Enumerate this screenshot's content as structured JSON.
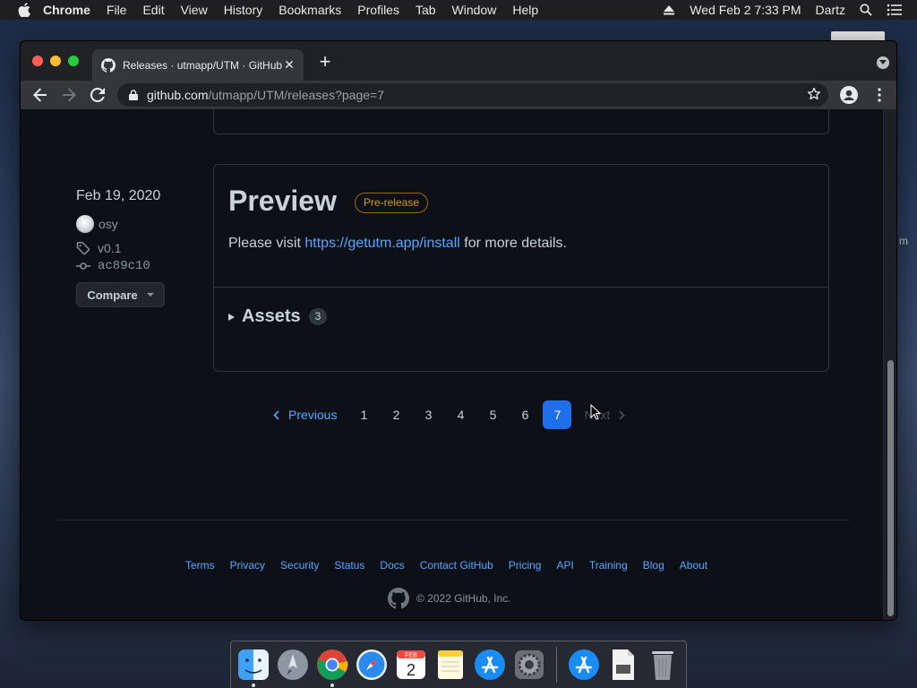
{
  "menubar": {
    "app_name": "Chrome",
    "items": [
      "File",
      "Edit",
      "View",
      "History",
      "Bookmarks",
      "Profiles",
      "Tab",
      "Window",
      "Help"
    ],
    "datetime": "Wed Feb 2  7:33 PM",
    "user": "Dartz"
  },
  "browser": {
    "tab_title": "Releases · utmapp/UTM · GitHub",
    "url_host": "github.com",
    "url_path": "/utmapp/UTM/releases?page=7"
  },
  "release": {
    "date": "Feb 19, 2020",
    "author": "osy",
    "tag": "v0.1",
    "commit": "ac89c10",
    "compare_label": "Compare",
    "title": "Preview",
    "badge": "Pre-release",
    "body_prefix": "Please visit ",
    "body_link": "https://getutm.app/install",
    "body_suffix": " for more details.",
    "assets_label": "Assets",
    "assets_count": "3"
  },
  "pagination": {
    "previous": "Previous",
    "pages": [
      "1",
      "2",
      "3",
      "4",
      "5",
      "6",
      "7"
    ],
    "current": "7",
    "next": "Next"
  },
  "footer": {
    "links": [
      "Terms",
      "Privacy",
      "Security",
      "Status",
      "Docs",
      "Contact GitHub",
      "Pricing",
      "API",
      "Training",
      "Blog",
      "About"
    ],
    "copyright": "© 2022 GitHub, Inc."
  },
  "desktop": {
    "side_label": "m"
  },
  "dock": {
    "apps": [
      "finder-icon",
      "launchpad-icon",
      "chrome-icon",
      "safari-icon",
      "calendar-icon",
      "notes-icon",
      "app-store-icon",
      "system-preferences-icon",
      "utm-icon",
      "file-icon",
      "trash-icon"
    ],
    "calendar_day": "2",
    "calendar_month": "FEB"
  },
  "colors": {
    "page_bg": "#0d1117",
    "link": "#58a6ff",
    "badge": "#d29922",
    "current_page": "#1f6feb"
  }
}
